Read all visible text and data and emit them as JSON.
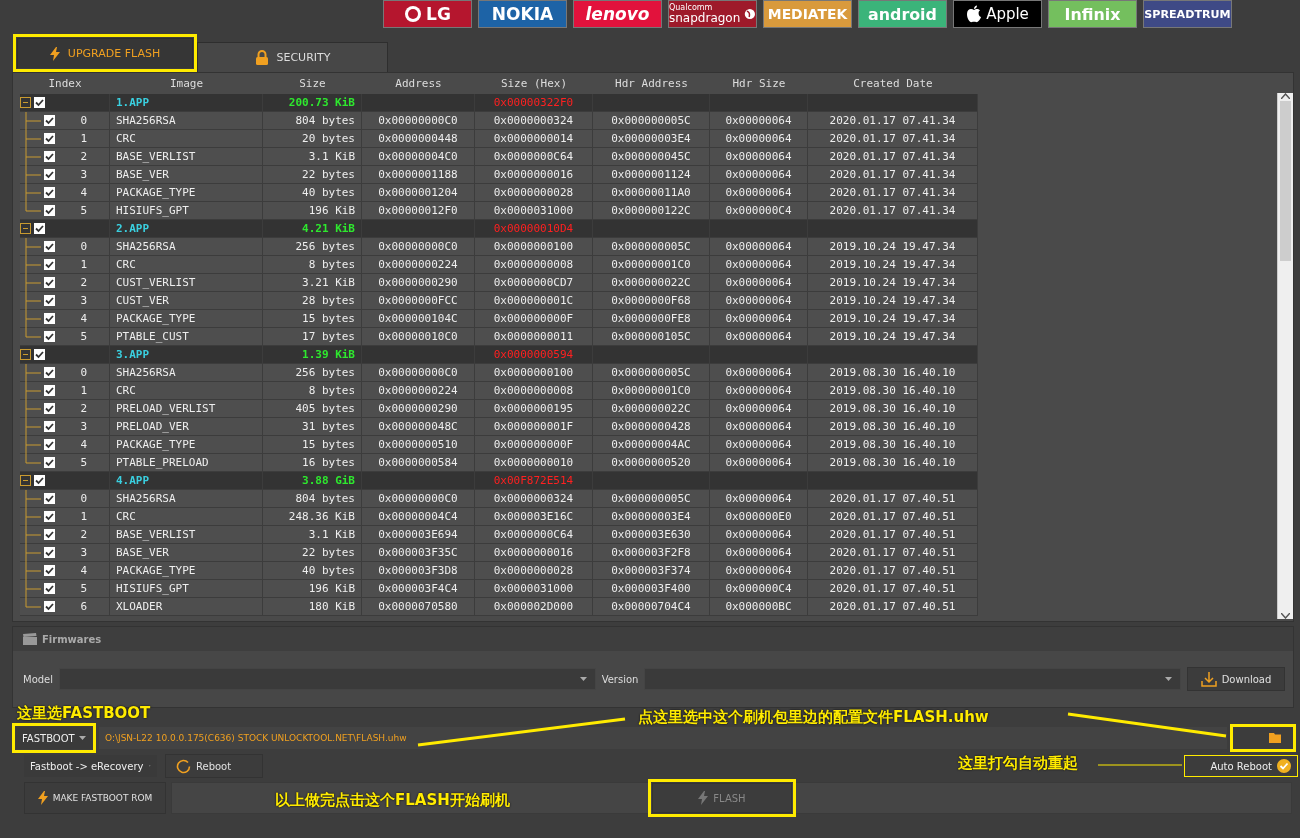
{
  "brand_logos": [
    {
      "kind": "lg",
      "label": "LG",
      "color": "#b5162e"
    },
    {
      "kind": "text",
      "label": "NOKIA",
      "color": "#1d63a6"
    },
    {
      "kind": "italic",
      "label": "lenovo",
      "color": "#e2123c"
    },
    {
      "kind": "snapdragon",
      "label": "snapdragon",
      "sublabel": "Qualcomm",
      "color": "#9e1a2a"
    },
    {
      "kind": "text",
      "label": "MEDIATEK",
      "color": "#d99a3c"
    },
    {
      "kind": "text",
      "label": "android",
      "color": "#3bb47a"
    },
    {
      "kind": "apple",
      "label": "Apple",
      "color": "#000000"
    },
    {
      "kind": "text",
      "label": "Infinix",
      "color": "#74bf5e"
    },
    {
      "kind": "text",
      "label": "SPREADTRUM",
      "color": "#3f4a86"
    }
  ],
  "tabs": [
    {
      "kind": "flash",
      "label": "UPGRADE FLASH",
      "selected": true,
      "highlighted": true
    },
    {
      "kind": "security",
      "label": "SECURITY",
      "selected": false,
      "highlighted": false
    }
  ],
  "table": {
    "columns": [
      "Index",
      "Image",
      "Size",
      "Address",
      "Size (Hex)",
      "Hdr Address",
      "Hdr Size",
      "Created Date"
    ],
    "groups": [
      {
        "image": "1.APP",
        "size": "200.73 KiB",
        "size_hex": "0x00000322F0",
        "checked": true,
        "expanded": true,
        "children": [
          {
            "checked": true,
            "index": "0",
            "image": "SHA256RSA",
            "size": "804 bytes",
            "address": "0x00000000C0",
            "size_hex": "0x0000000324",
            "hdr_address": "0x000000005C",
            "hdr_size": "0x00000064",
            "created_date": "2020.01.17 07.41.34"
          },
          {
            "checked": true,
            "index": "1",
            "image": "CRC",
            "size": "20 bytes",
            "address": "0x0000000448",
            "size_hex": "0x0000000014",
            "hdr_address": "0x00000003E4",
            "hdr_size": "0x00000064",
            "created_date": "2020.01.17 07.41.34"
          },
          {
            "checked": true,
            "index": "2",
            "image": "BASE_VERLIST",
            "size": "3.1 KiB",
            "address": "0x00000004C0",
            "size_hex": "0x0000000C64",
            "hdr_address": "0x000000045C",
            "hdr_size": "0x00000064",
            "created_date": "2020.01.17 07.41.34"
          },
          {
            "checked": true,
            "index": "3",
            "image": "BASE_VER",
            "size": "22 bytes",
            "address": "0x0000001188",
            "size_hex": "0x0000000016",
            "hdr_address": "0x0000001124",
            "hdr_size": "0x00000064",
            "created_date": "2020.01.17 07.41.34"
          },
          {
            "checked": true,
            "index": "4",
            "image": "PACKAGE_TYPE",
            "size": "40 bytes",
            "address": "0x0000001204",
            "size_hex": "0x0000000028",
            "hdr_address": "0x00000011A0",
            "hdr_size": "0x00000064",
            "created_date": "2020.01.17 07.41.34"
          },
          {
            "checked": true,
            "index": "5",
            "image": "HISIUFS_GPT",
            "size": "196 KiB",
            "address": "0x00000012F0",
            "size_hex": "0x0000031000",
            "hdr_address": "0x000000122C",
            "hdr_size": "0x000000C4",
            "created_date": "2020.01.17 07.41.34"
          }
        ]
      },
      {
        "image": "2.APP",
        "size": "4.21 KiB",
        "size_hex": "0x00000010D4",
        "checked": true,
        "expanded": true,
        "children": [
          {
            "checked": true,
            "index": "0",
            "image": "SHA256RSA",
            "size": "256 bytes",
            "address": "0x00000000C0",
            "size_hex": "0x0000000100",
            "hdr_address": "0x000000005C",
            "hdr_size": "0x00000064",
            "created_date": "2019.10.24 19.47.34"
          },
          {
            "checked": true,
            "index": "1",
            "image": "CRC",
            "size": "8 bytes",
            "address": "0x0000000224",
            "size_hex": "0x0000000008",
            "hdr_address": "0x00000001C0",
            "hdr_size": "0x00000064",
            "created_date": "2019.10.24 19.47.34"
          },
          {
            "checked": true,
            "index": "2",
            "image": "CUST_VERLIST",
            "size": "3.21 KiB",
            "address": "0x0000000290",
            "size_hex": "0x0000000CD7",
            "hdr_address": "0x000000022C",
            "hdr_size": "0x00000064",
            "created_date": "2019.10.24 19.47.34"
          },
          {
            "checked": true,
            "index": "3",
            "image": "CUST_VER",
            "size": "28 bytes",
            "address": "0x0000000FCC",
            "size_hex": "0x000000001C",
            "hdr_address": "0x0000000F68",
            "hdr_size": "0x00000064",
            "created_date": "2019.10.24 19.47.34"
          },
          {
            "checked": true,
            "index": "4",
            "image": "PACKAGE_TYPE",
            "size": "15 bytes",
            "address": "0x000000104C",
            "size_hex": "0x000000000F",
            "hdr_address": "0x0000000FE8",
            "hdr_size": "0x00000064",
            "created_date": "2019.10.24 19.47.34"
          },
          {
            "checked": true,
            "index": "5",
            "image": "PTABLE_CUST",
            "size": "17 bytes",
            "address": "0x00000010C0",
            "size_hex": "0x0000000011",
            "hdr_address": "0x000000105C",
            "hdr_size": "0x00000064",
            "created_date": "2019.10.24 19.47.34"
          }
        ]
      },
      {
        "image": "3.APP",
        "size": "1.39 KiB",
        "size_hex": "0x0000000594",
        "checked": true,
        "expanded": true,
        "children": [
          {
            "checked": true,
            "index": "0",
            "image": "SHA256RSA",
            "size": "256 bytes",
            "address": "0x00000000C0",
            "size_hex": "0x0000000100",
            "hdr_address": "0x000000005C",
            "hdr_size": "0x00000064",
            "created_date": "2019.08.30 16.40.10"
          },
          {
            "checked": true,
            "index": "1",
            "image": "CRC",
            "size": "8 bytes",
            "address": "0x0000000224",
            "size_hex": "0x0000000008",
            "hdr_address": "0x00000001C0",
            "hdr_size": "0x00000064",
            "created_date": "2019.08.30 16.40.10"
          },
          {
            "checked": true,
            "index": "2",
            "image": "PRELOAD_VERLIST",
            "size": "405 bytes",
            "address": "0x0000000290",
            "size_hex": "0x0000000195",
            "hdr_address": "0x000000022C",
            "hdr_size": "0x00000064",
            "created_date": "2019.08.30 16.40.10"
          },
          {
            "checked": true,
            "index": "3",
            "image": "PRELOAD_VER",
            "size": "31 bytes",
            "address": "0x000000048C",
            "size_hex": "0x000000001F",
            "hdr_address": "0x0000000428",
            "hdr_size": "0x00000064",
            "created_date": "2019.08.30 16.40.10"
          },
          {
            "checked": true,
            "index": "4",
            "image": "PACKAGE_TYPE",
            "size": "15 bytes",
            "address": "0x0000000510",
            "size_hex": "0x000000000F",
            "hdr_address": "0x00000004AC",
            "hdr_size": "0x00000064",
            "created_date": "2019.08.30 16.40.10"
          },
          {
            "checked": true,
            "index": "5",
            "image": "PTABLE_PRELOAD",
            "size": "16 bytes",
            "address": "0x0000000584",
            "size_hex": "0x0000000010",
            "hdr_address": "0x0000000520",
            "hdr_size": "0x00000064",
            "created_date": "2019.08.30 16.40.10"
          }
        ]
      },
      {
        "image": "4.APP",
        "size": "3.88 GiB",
        "size_hex": "0x00F872E514",
        "checked": true,
        "expanded": true,
        "children": [
          {
            "checked": true,
            "index": "0",
            "image": "SHA256RSA",
            "size": "804 bytes",
            "address": "0x00000000C0",
            "size_hex": "0x0000000324",
            "hdr_address": "0x000000005C",
            "hdr_size": "0x00000064",
            "created_date": "2020.01.17 07.40.51"
          },
          {
            "checked": true,
            "index": "1",
            "image": "CRC",
            "size": "248.36 KiB",
            "address": "0x00000004C4",
            "size_hex": "0x000003E16C",
            "hdr_address": "0x00000003E4",
            "hdr_size": "0x000000E0",
            "created_date": "2020.01.17 07.40.51"
          },
          {
            "checked": true,
            "index": "2",
            "image": "BASE_VERLIST",
            "size": "3.1 KiB",
            "address": "0x000003E694",
            "size_hex": "0x0000000C64",
            "hdr_address": "0x000003E630",
            "hdr_size": "0x00000064",
            "created_date": "2020.01.17 07.40.51"
          },
          {
            "checked": true,
            "index": "3",
            "image": "BASE_VER",
            "size": "22 bytes",
            "address": "0x000003F35C",
            "size_hex": "0x0000000016",
            "hdr_address": "0x000003F2F8",
            "hdr_size": "0x00000064",
            "created_date": "2020.01.17 07.40.51"
          },
          {
            "checked": true,
            "index": "4",
            "image": "PACKAGE_TYPE",
            "size": "40 bytes",
            "address": "0x000003F3D8",
            "size_hex": "0x0000000028",
            "hdr_address": "0x000003F374",
            "hdr_size": "0x00000064",
            "created_date": "2020.01.17 07.40.51"
          },
          {
            "checked": true,
            "index": "5",
            "image": "HISIUFS_GPT",
            "size": "196 KiB",
            "address": "0x000003F4C4",
            "size_hex": "0x0000031000",
            "hdr_address": "0x000003F400",
            "hdr_size": "0x000000C4",
            "created_date": "2020.01.17 07.40.51"
          },
          {
            "checked": true,
            "index": "6",
            "image": "XLOADER",
            "size": "180 KiB",
            "address": "0x0000070580",
            "size_hex": "0x000002D000",
            "hdr_address": "0x00000704C4",
            "hdr_size": "0x000000BC",
            "created_date": "2020.01.17 07.40.51"
          }
        ]
      }
    ]
  },
  "firmwares": {
    "title": "Firmwares",
    "model_label": "Model",
    "version_label": "Version",
    "download_button": "Download"
  },
  "mode_select": {
    "value": "FASTBOOT",
    "highlighted": true
  },
  "file_path": {
    "value": "O:\\JSN-L22 10.0.0.175(C636) STOCK UNLOCKTOOL.NET\\FLASH.uhw"
  },
  "browse_button": {
    "highlighted": true
  },
  "reboot_mode_select": {
    "value": "Fastboot -> eRecovery"
  },
  "reboot_button": "Reboot",
  "auto_reboot": {
    "label": "Auto Reboot",
    "checked": true,
    "highlighted": true
  },
  "make_rom_button": "MAKE FASTBOOT ROM",
  "flash_button": {
    "label": "FLASH",
    "disabled": true,
    "highlighted": true
  },
  "annotations": [
    {
      "text": "这里选FASTBOOT"
    },
    {
      "text": "点这里选中这个刷机包里边的配置文件FLASH.uhw"
    },
    {
      "text": "这里打勾自动重起"
    },
    {
      "text": "以上做完点击这个FLASH开始刷机"
    }
  ]
}
